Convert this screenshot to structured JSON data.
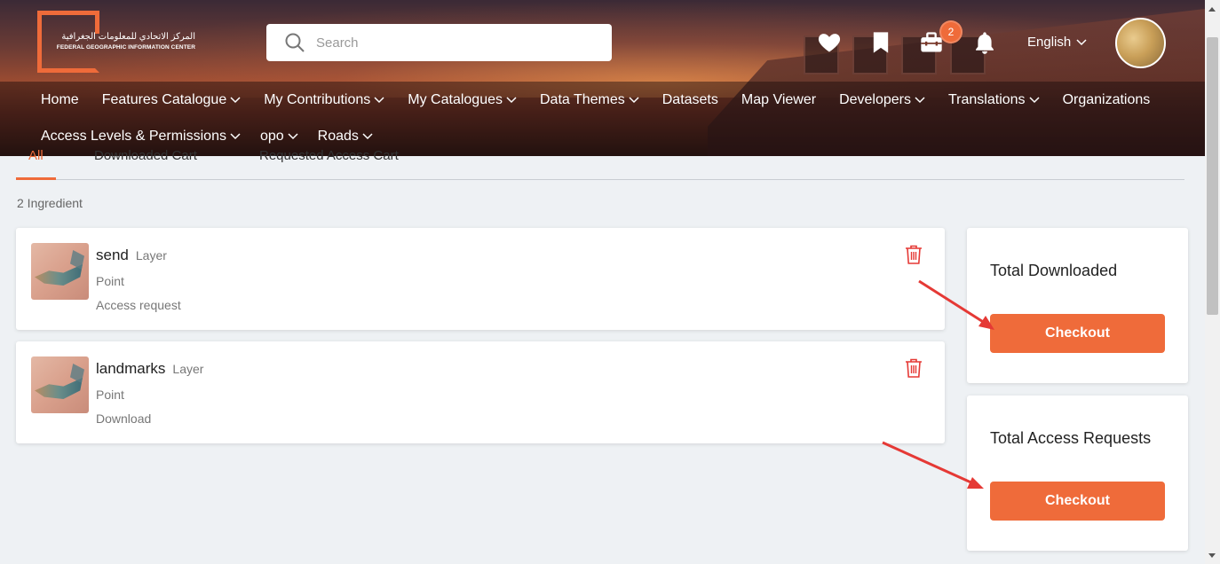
{
  "header": {
    "logo_arabic": "المركز الاتحادي للمعلومات الجغرافية",
    "logo_english": "FEDERAL GEOGRAPHIC INFORMATION CENTER",
    "search_placeholder": "Search",
    "cart_badge": "2",
    "language": "English"
  },
  "nav": {
    "row1": [
      "Home",
      "Features Catalogue",
      "My Contributions",
      "My Catalogues",
      "Data Themes",
      "Datasets",
      "Map Viewer",
      "Developers",
      "Translations",
      "Organizations"
    ],
    "row2": [
      "Access Levels & Permissions",
      "opo",
      "Roads"
    ]
  },
  "tabs": [
    "All",
    "Downloaded Cart",
    "Requested Access Cart"
  ],
  "ingredient_count": "2 Ingredient",
  "items": [
    {
      "name": "send",
      "type": "Layer",
      "geometry": "Point",
      "request": "Access request"
    },
    {
      "name": "landmarks",
      "type": "Layer",
      "geometry": "Point",
      "request": "Download"
    }
  ],
  "summary": {
    "downloaded_title": "Total Downloaded",
    "downloaded_button": "Checkout",
    "access_title": "Total Access Requests",
    "access_button": "Checkout"
  },
  "colors": {
    "accent": "#ef6b3a",
    "annotation_arrow": "#e53935"
  }
}
